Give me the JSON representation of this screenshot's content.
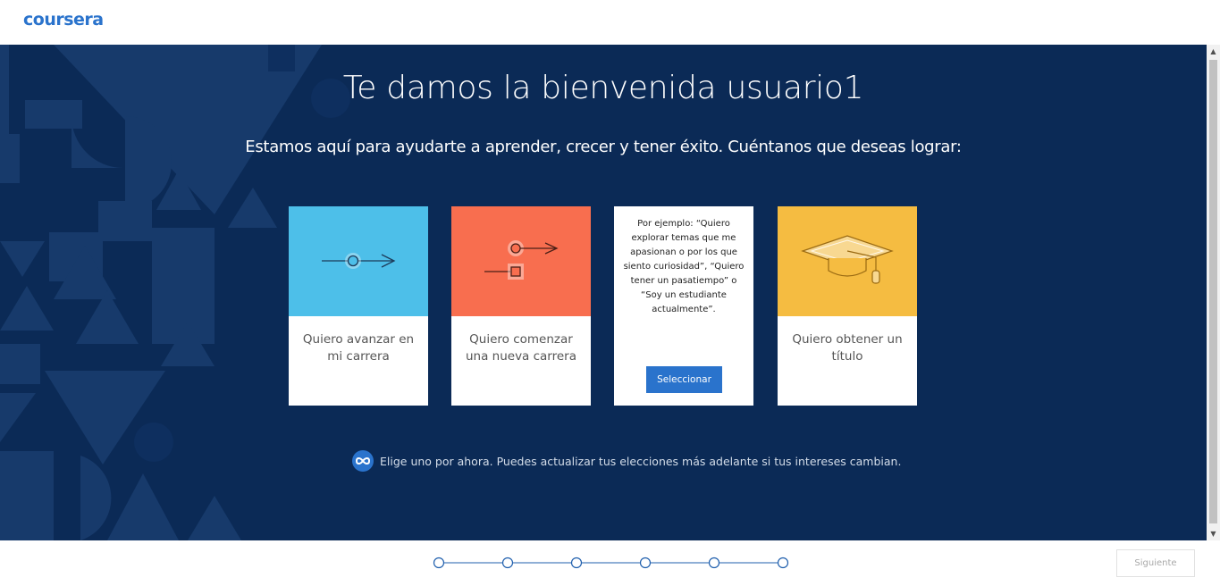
{
  "header": {
    "logo_text": "coursera"
  },
  "main": {
    "title": "Te damos la bienvenida usuario1",
    "subtitle": "Estamos aquí para ayudarte a aprender, crecer y tener éxito. Cuéntanos que deseas lograr:",
    "cards": [
      {
        "label": "Quiero avanzar en mi carrera",
        "color": "#4dbfe9",
        "icon": "career-advance-icon"
      },
      {
        "label": "Quiero comenzar una nueva carrera",
        "color": "#f86e4f",
        "icon": "career-change-icon"
      },
      {
        "description": "Por ejemplo: “Quiero explorar temas que me apasionan o por los que siento curiosidad”, “Quiero tener un pasatiempo” o “Soy un estudiante actualmente”.",
        "button_label": "Seleccionar"
      },
      {
        "label": "Quiero obtener un título",
        "color": "#f5bc41",
        "icon": "graduation-cap-icon"
      }
    ],
    "note": "Elige uno por ahora. Puedes actualizar tus elecciones más adelante si tus intereses cambian.",
    "note_icon": "infinity-icon"
  },
  "footer": {
    "progress_steps": 6,
    "next_label": "Siguiente"
  },
  "colors": {
    "brand": "#2a73cc",
    "background": "#0b2a56"
  }
}
